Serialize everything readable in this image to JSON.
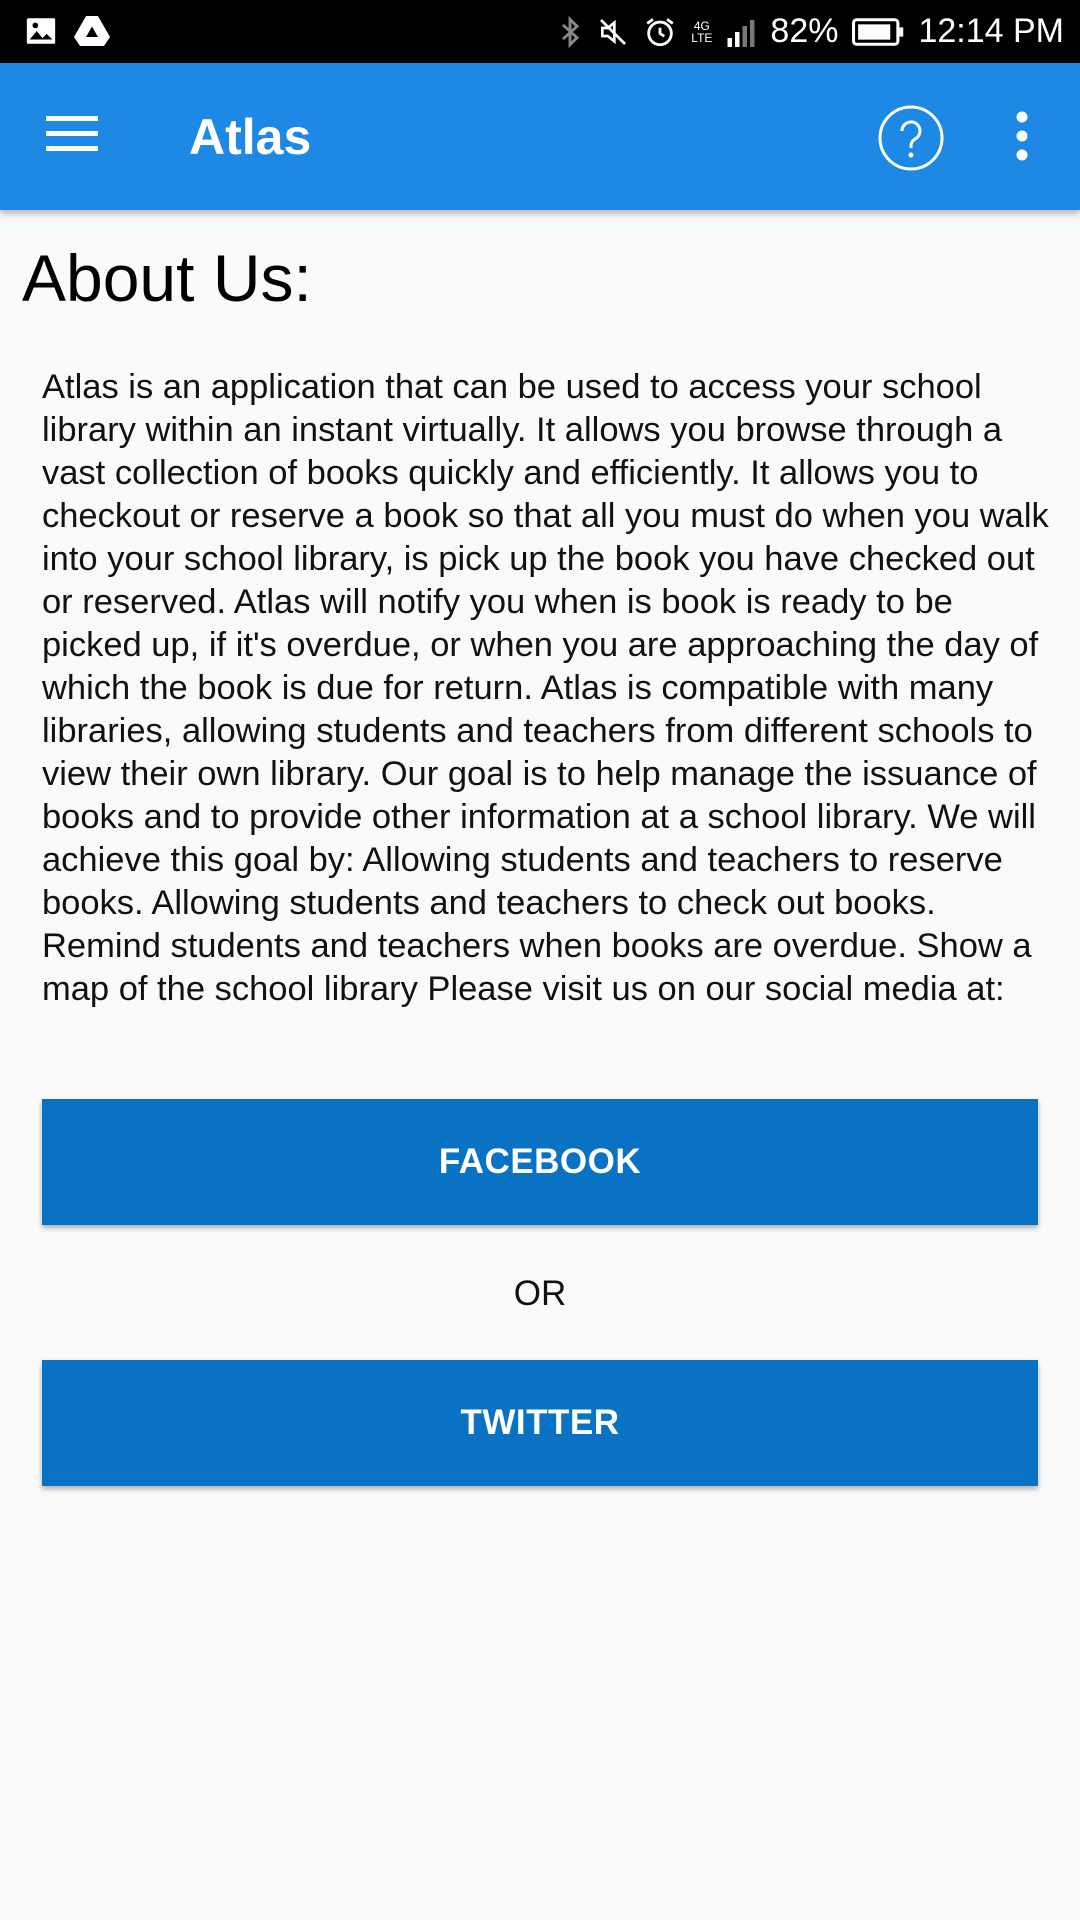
{
  "status_bar": {
    "battery_percent": "82%",
    "time": "12:14 PM",
    "network_label_top": "4G",
    "network_label_bottom": "LTE",
    "icons": [
      "gallery-icon",
      "drive-icon",
      "bluetooth-icon",
      "mute-icon",
      "alarm-icon",
      "signal-icon",
      "battery-icon"
    ]
  },
  "app_bar": {
    "title": "Atlas",
    "color": "#1e88e5",
    "icons": [
      "menu-icon",
      "help-icon",
      "more-vert-icon"
    ]
  },
  "content": {
    "heading": "About Us:",
    "body": "Atlas is an application that can be used to access your school library within an instant virtually. It allows you browse through a vast collection of books quickly and efficiently. It allows you to checkout or reserve a book so that all you must do when you walk into your school library, is pick up the book you have checked out or reserved. Atlas will notify you when is book is ready to be picked up, if it's overdue, or when you are approaching the day of which the book is due for return. Atlas is compatible with many libraries, allowing students and teachers from different schools to view their own library. Our goal is to help manage the issuance of books and to provide other information at a school library. We will achieve this goal by: Allowing students and teachers to reserve books. Allowing students and teachers to check out books. Remind students and teachers when books are overdue. Show a map of the school library Please visit us on our social media at:",
    "facebook_label": "FACEBOOK",
    "or_label": "OR",
    "twitter_label": "TWITTER",
    "button_color": "#0a72c2"
  }
}
